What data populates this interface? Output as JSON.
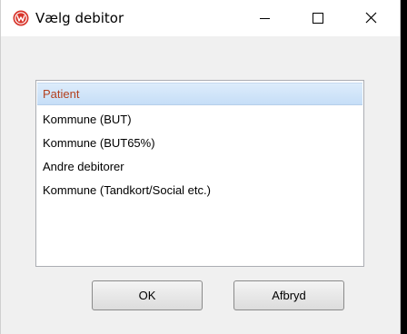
{
  "window": {
    "title": "Vælg debitor",
    "icon": "red-logo-icon"
  },
  "controls": {
    "minimize": "minimize-icon",
    "maximize": "maximize-icon",
    "close": "close-icon"
  },
  "debtor_list": {
    "selected_index": 0,
    "items": [
      "Patient",
      "Kommune (BUT)",
      "Kommune (BUT65%)",
      "Andre debitorer",
      "Kommune (Tandkort/Social etc.)"
    ]
  },
  "buttons": {
    "ok": "OK",
    "cancel": "Afbryd"
  },
  "colors": {
    "selected_text": "#b3401e",
    "selected_background": "#cde3f9",
    "dialog_background": "#f0f0f0"
  }
}
